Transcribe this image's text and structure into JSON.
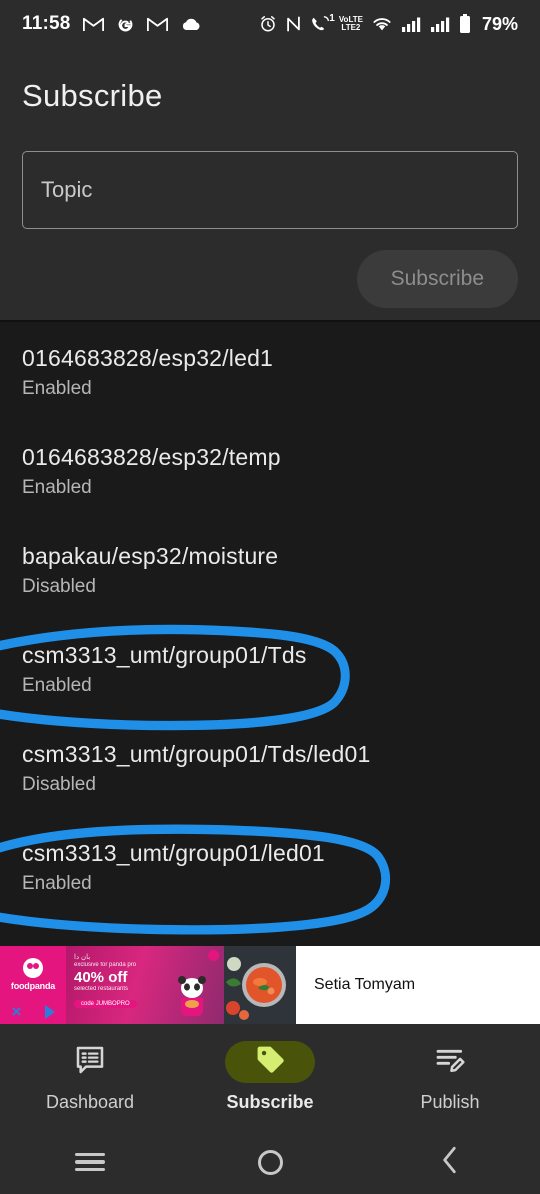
{
  "statusbar": {
    "time": "11:58",
    "battery_percent": "79%",
    "left_icons": [
      "gmail-icon",
      "google-icon",
      "gmail-icon",
      "cloud-icon"
    ],
    "right_icons": [
      "alarm-icon",
      "nfc-icon",
      "call-icon",
      "volte2-icon",
      "wifi-icon",
      "signal-icon",
      "signal-icon",
      "battery-icon"
    ],
    "call_badge": "1",
    "volte_label": "VoLTE",
    "volte_sub": "2"
  },
  "header": {
    "title": "Subscribe",
    "topic_input": {
      "value": "",
      "placeholder": "Topic"
    },
    "subscribe_button": {
      "label": "Subscribe",
      "enabled": false
    }
  },
  "topics": [
    {
      "name": "0164683828/esp32/led1",
      "state": "Enabled",
      "annotated": false
    },
    {
      "name": "0164683828/esp32/temp",
      "state": "Enabled",
      "annotated": false
    },
    {
      "name": "bapakau/esp32/moisture",
      "state": "Disabled",
      "annotated": false
    },
    {
      "name": "csm3313_umt/group01/Tds",
      "state": "Enabled",
      "annotated": true
    },
    {
      "name": "csm3313_umt/group01/Tds/led01",
      "state": "Disabled",
      "annotated": false
    },
    {
      "name": "csm3313_umt/group01/led01",
      "state": "Enabled",
      "annotated": true
    }
  ],
  "annotation": {
    "color": "#1f8fe8",
    "shape": "hand-drawn-ellipse",
    "count": 2
  },
  "ad": {
    "brand": "foodpanda",
    "headline": "40% off",
    "arabic_line": "بان دا",
    "exclusive_line": "exclusive for panda pro",
    "sub_line": "selected restaurants",
    "code_label": "code",
    "code_value": "JUMBOPRO",
    "restaurant": "Setia Tomyam",
    "close_label": "×",
    "info_label": "i"
  },
  "bottom_nav": {
    "items": [
      {
        "label": "Dashboard",
        "icon": "message-list-icon",
        "active": false
      },
      {
        "label": "Subscribe",
        "icon": "tag-icon",
        "active": true
      },
      {
        "label": "Publish",
        "icon": "compose-icon",
        "active": false
      }
    ],
    "active_pill_color": "#49540a",
    "active_icon_color": "#d5ed70"
  },
  "system_nav": {
    "recents": "recents-icon",
    "home": "home-icon",
    "back": "back-icon"
  }
}
